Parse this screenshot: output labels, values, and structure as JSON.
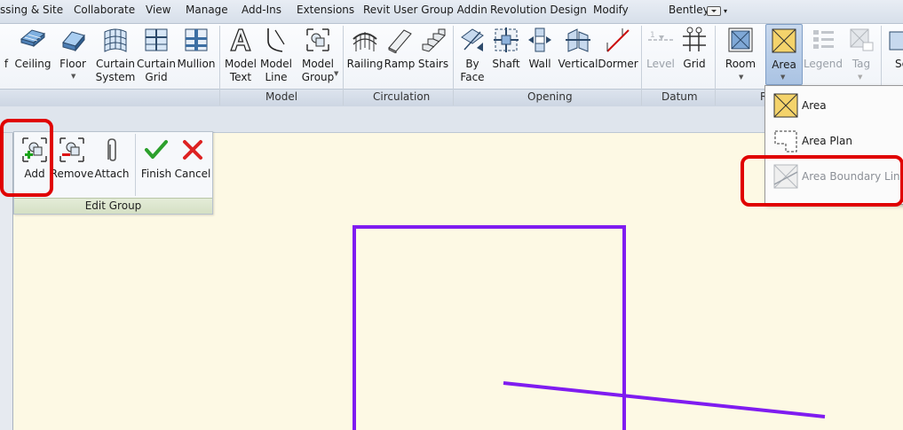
{
  "menubar": {
    "items": [
      "ssing & Site",
      "Collaborate",
      "View",
      "Manage",
      "Add-Ins",
      "Extensions",
      "Revit User Group Addin",
      "Revolution Design",
      "Modify",
      "Bentley"
    ]
  },
  "ribbon": {
    "tools": [
      {
        "name": "floor-tool-partial",
        "label": "f"
      },
      {
        "name": "ceiling-tool",
        "label": "Ceiling"
      },
      {
        "name": "floor-tool",
        "label": "Floor"
      },
      {
        "name": "curtain-system-tool",
        "label": "Curtain\nSystem"
      },
      {
        "name": "curtain-grid-tool",
        "label": "Curtain\nGrid"
      },
      {
        "name": "mullion-tool",
        "label": "Mullion"
      },
      {
        "name": "model-text-tool",
        "label": "Model\nText"
      },
      {
        "name": "model-line-tool",
        "label": "Model\nLine"
      },
      {
        "name": "model-group-tool",
        "label": "Model\nGroup"
      },
      {
        "name": "railing-tool",
        "label": "Railing"
      },
      {
        "name": "ramp-tool",
        "label": "Ramp"
      },
      {
        "name": "stairs-tool",
        "label": "Stairs"
      },
      {
        "name": "by-face-tool",
        "label": "By\nFace"
      },
      {
        "name": "shaft-tool",
        "label": "Shaft"
      },
      {
        "name": "wall-opening-tool",
        "label": "Wall"
      },
      {
        "name": "vertical-tool",
        "label": "Vertical"
      },
      {
        "name": "dormer-tool",
        "label": "Dormer"
      },
      {
        "name": "level-tool",
        "label": "Level"
      },
      {
        "name": "grid-tool",
        "label": "Grid"
      },
      {
        "name": "room-tool",
        "label": "Room"
      },
      {
        "name": "area-tool",
        "label": "Area"
      },
      {
        "name": "legend-tool",
        "label": "Legend"
      },
      {
        "name": "tag-tool",
        "label": "Tag"
      },
      {
        "name": "set-tool-partial",
        "label": "Se"
      }
    ],
    "panels": [
      "Model",
      "Circulation",
      "Opening",
      "Datum",
      "R"
    ]
  },
  "edit_group": {
    "tools": [
      {
        "label": "Add"
      },
      {
        "label": "Remove"
      },
      {
        "label": "Attach"
      },
      {
        "label": "Finish"
      },
      {
        "label": "Cancel"
      }
    ],
    "title": "Edit Group"
  },
  "area_menu": {
    "items": [
      {
        "label": "Area"
      },
      {
        "label": "Area Plan"
      },
      {
        "label": "Area Boundary Line"
      }
    ]
  },
  "colors": {
    "canvas": "#fdf9e4",
    "boundary_line": "#7f1cf0",
    "highlight": "#e00000"
  }
}
